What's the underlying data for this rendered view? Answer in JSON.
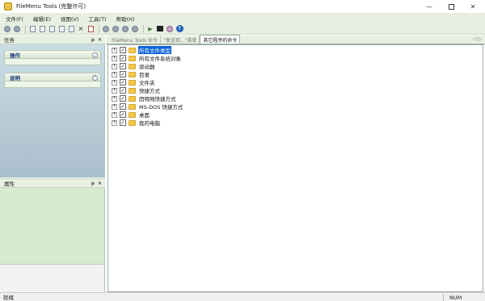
{
  "window": {
    "title": "FileMenu Tools (完整许可)",
    "minimize_glyph": "—",
    "maximize_glyph": "",
    "close_glyph": "✕"
  },
  "menubar": {
    "items": [
      {
        "label": "文件(F)"
      },
      {
        "label": "编辑(E)"
      },
      {
        "label": "视图(V)"
      },
      {
        "label": "工具(T)"
      },
      {
        "label": "帮助(H)"
      }
    ]
  },
  "toolbar": {
    "buttons": [
      {
        "icon": "back-circle-icon"
      },
      {
        "icon": "forward-circle-icon"
      },
      {
        "icon": "new-document-icon"
      },
      {
        "icon": "copy-document-icon"
      },
      {
        "icon": "paste-document-icon"
      },
      {
        "icon": "edit-document-icon"
      },
      {
        "icon": "properties-document-icon"
      },
      {
        "icon": "delete-icon"
      },
      {
        "icon": "check-icon"
      },
      {
        "icon": "move-up-icon"
      },
      {
        "icon": "move-down-icon"
      },
      {
        "icon": "move-left-icon"
      },
      {
        "icon": "move-right-icon"
      },
      {
        "icon": "run-icon"
      },
      {
        "icon": "dos-icon"
      },
      {
        "icon": "settings-icon"
      },
      {
        "icon": "help-icon"
      }
    ],
    "help_glyph": "?"
  },
  "task_pane": {
    "title": "任务",
    "pin_glyph": "ᵽ",
    "close_glyph": "✕",
    "groups": [
      {
        "label": "操作",
        "toggle": "⌄"
      },
      {
        "label": "说明",
        "toggle": "⌃"
      }
    ]
  },
  "properties_pane": {
    "title": "属性",
    "pin_glyph": "ᵽ",
    "close_glyph": "✕"
  },
  "tabs": [
    {
      "label": "FileMenu Tools 命令",
      "active": false
    },
    {
      "label": "\"发送到...\"菜单",
      "active": false
    },
    {
      "label": "其它程序的命令",
      "active": true
    }
  ],
  "tab_nav": "◁ ▷",
  "tree": {
    "items": [
      {
        "label": "所有文件类型",
        "checked": true,
        "selected": true
      },
      {
        "label": "所有文件系统对象",
        "checked": true,
        "selected": false
      },
      {
        "label": "驱动器",
        "checked": true,
        "selected": false
      },
      {
        "label": "目录",
        "checked": true,
        "selected": false
      },
      {
        "label": "文件夹",
        "checked": true,
        "selected": false
      },
      {
        "label": "快捷方式",
        "checked": true,
        "selected": false
      },
      {
        "label": "因特网快捷方式",
        "checked": true,
        "selected": false
      },
      {
        "label": "MS-DOS 快捷方式",
        "checked": true,
        "selected": false
      },
      {
        "label": "桌面",
        "checked": true,
        "selected": false
      },
      {
        "label": "我的电脑",
        "checked": true,
        "selected": false
      }
    ],
    "expander_glyph": "+",
    "check_glyph": "✓"
  },
  "statusbar": {
    "text": "就绪",
    "num": "NUM"
  },
  "colors": {
    "selection": "#0a5fd6",
    "chrome": "#e7efe2",
    "task_pane": "#b8cdd8",
    "properties_pane": "#d6ebcf"
  }
}
